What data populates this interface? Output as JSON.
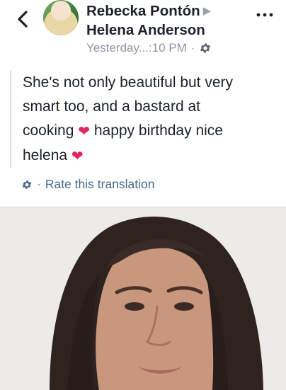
{
  "header": {
    "author": "Rebecka Pontón",
    "recipient": "Helena Anderson",
    "timestamp": "Yesterday...:10 PM",
    "privacy_separator": "·",
    "privacy_icon": "gear-icon",
    "back_icon": "back-chevron-icon",
    "more_icon": "more-icon"
  },
  "post": {
    "line1": "She's not only beautiful but very",
    "line2": "smart too, and a bastard at",
    "line3a": "cooking",
    "line3b": "happy birthday nice",
    "line4": "helena"
  },
  "translation": {
    "separator": "·",
    "label": "Rate this translation"
  },
  "colors": {
    "name": "#1d2129",
    "meta": "#90949c",
    "link": "#4b6a8b",
    "heart": "#e0245e"
  }
}
